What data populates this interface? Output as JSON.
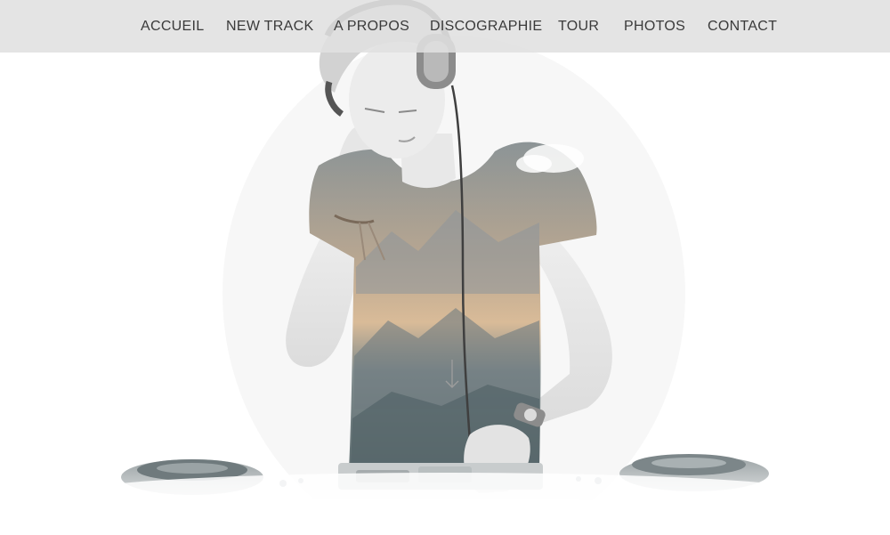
{
  "nav": {
    "items": [
      {
        "id": "accueil",
        "label": "ACCUEIL"
      },
      {
        "id": "new-track",
        "label": "NEW TRACK"
      },
      {
        "id": "a-propos",
        "label": "A PROPOS"
      },
      {
        "id": "discographie",
        "label": "DISCOGRAPHIE"
      },
      {
        "id": "tour",
        "label": "TOUR"
      },
      {
        "id": "photos",
        "label": "PHOTOS"
      },
      {
        "id": "contact",
        "label": "CONTACT"
      }
    ]
  },
  "hero": {
    "image": "dj-with-headphones-double-exposure-mountains",
    "scroll_icon": "arrow-down-icon"
  },
  "colors": {
    "nav_background": "#e0e0e0",
    "nav_text": "#3a3a3a",
    "page_background": "#ffffff",
    "shirt_tone": "#7d8a8c",
    "sunset_tone": "#d9b38c"
  }
}
